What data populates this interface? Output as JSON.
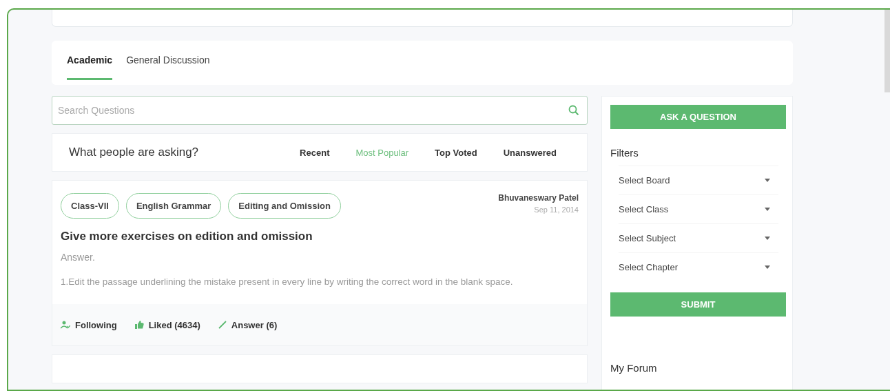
{
  "tabs": [
    {
      "label": "Academic",
      "selected": true
    },
    {
      "label": "General Discussion",
      "selected": false
    }
  ],
  "search": {
    "placeholder": "Search Questions"
  },
  "feed": {
    "heading": "What people are asking?",
    "sorts": [
      {
        "label": "Recent",
        "selected": false
      },
      {
        "label": "Most Popular",
        "selected": true
      },
      {
        "label": "Top Voted",
        "selected": false
      },
      {
        "label": "Unanswered",
        "selected": false
      }
    ]
  },
  "question": {
    "tags": [
      "Class-VII",
      "English Grammar",
      "Editing and Omission"
    ],
    "author": "Bhuvaneswary Patel",
    "date": "Sep 11, 2014",
    "title": "Give more exercises on edition and omission",
    "answer_label": "Answer.",
    "answer": "1.Edit the passage underlining the mistake present in every line by writing the correct word in the blank space.",
    "actions": [
      {
        "kind": "follow",
        "label": "Following"
      },
      {
        "kind": "like",
        "label": "Liked (4634)"
      },
      {
        "kind": "answer",
        "label": "Answer (6)"
      }
    ]
  },
  "sidebar": {
    "ask_button": "ASK A QUESTION",
    "filters_title": "Filters",
    "filters": [
      "Select Board",
      "Select Class",
      "Select Subject",
      "Select Chapter"
    ],
    "submit_button": "SUBMIT",
    "my_forum_title": "My Forum"
  }
}
